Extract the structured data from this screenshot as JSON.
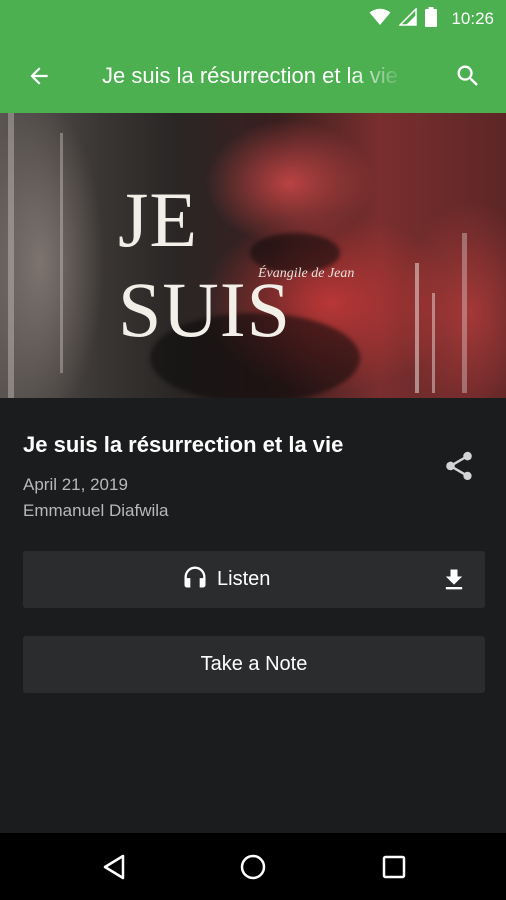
{
  "status_bar": {
    "time": "10:26",
    "icons": [
      "wifi-icon",
      "signal-icon",
      "battery-icon"
    ]
  },
  "app_bar": {
    "title": "Je suis la résurrection et la vie",
    "back_icon": "arrow-left-icon",
    "search_icon": "search-icon",
    "color": "#4caf50"
  },
  "hero": {
    "title": "JE SUIS",
    "subtitle": "Évangile de Jean"
  },
  "sermon": {
    "title": "Je suis la résurrection et la vie",
    "date": "April 21, 2019",
    "speaker": "Emmanuel Diafwila"
  },
  "actions": {
    "listen_label": "Listen",
    "take_note_label": "Take a Note",
    "share_icon": "share-icon",
    "download_icon": "download-icon",
    "headphones_icon": "headphones-icon"
  },
  "nav_bar": {
    "buttons": [
      "back-triangle-icon",
      "home-circle-icon",
      "recents-square-icon"
    ]
  },
  "colors": {
    "accent": "#4caf50",
    "background": "#1b1c1e",
    "button": "#2b2c2e",
    "secondary_text": "#b8b8b8"
  }
}
